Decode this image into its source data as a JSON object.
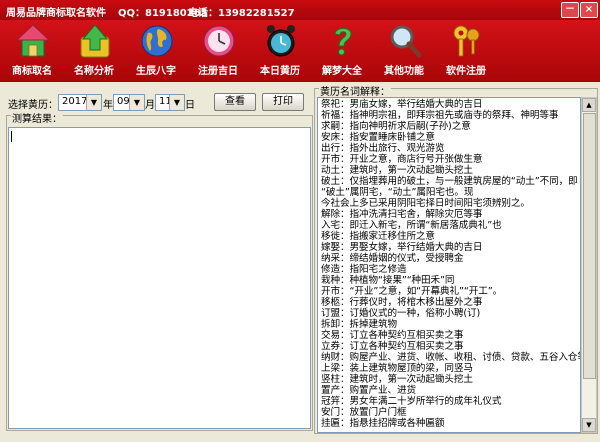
{
  "titlebar": {
    "app_name": "周易品牌商标取名软件",
    "qq": "QQ：819180265",
    "tel": "电话：13982281527",
    "min_symbol": "－",
    "close_symbol": "×"
  },
  "toolbar": [
    {
      "label": "商标取名",
      "icon": "house-icon"
    },
    {
      "label": "名称分析",
      "icon": "upload-arrow-icon"
    },
    {
      "label": "生辰八字",
      "icon": "globe-icon"
    },
    {
      "label": "注册吉日",
      "icon": "clock-icon"
    },
    {
      "label": "本日黄历",
      "icon": "alarm-clock-icon"
    },
    {
      "label": "解梦大全",
      "icon": "question-icon"
    },
    {
      "label": "其他功能",
      "icon": "magnifier-icon"
    },
    {
      "label": "软件注册",
      "icon": "keys-icon"
    }
  ],
  "selector": {
    "label": "选择黄历：",
    "year": "2017",
    "year_unit": "年",
    "month": "09",
    "month_unit": "月",
    "day": "11",
    "day_unit": "日",
    "dropdown_glyph": "▼",
    "view_button": "查看",
    "print_button": "打印"
  },
  "result": {
    "legend": "测算结果：",
    "text": ""
  },
  "glossary": {
    "legend": "黄历名词解释：",
    "lines": [
      "祭祀：男庙女嫁，举行结婚大典的吉日",
      "祈福：指神明宗祖，即拜宗祖先或庙寺的祭拜、神明等事",
      "求嗣：指向神明祈求后嗣(子孙)之意",
      "安床：指安置睡床卧铺之意",
      "出行：指外出旅行、观光游览",
      "开市：开业之意，商店行号开张做生意",
      "动土：建筑时，第一次动起锄头挖土",
      "破土：仅指埋葬用的破土，与一般建筑房屋的“动土”不同，即",
      "“破土”属阴宅，“动土”属阳宅也。现",
      "今社会上多已采用阴阳宅择日时间阳宅须辨别之。",
      "解除：指冲洗清扫宅舍，解除灾厄等事",
      "入宅：即迁入新宅，所谓“新居落成典礼”也",
      "移徙：指搬家迁移住所之意",
      "嫁娶：男娶女嫁，举行结婚大典的吉日",
      "纳采：缔结婚姻的仪式，受授聘金",
      "修造：指阳宅之修造",
      "栽种：种植物“接果”“种田禾”同",
      "开市：“开业”之意，如“开幕典礼”“开工”。",
      "移柩：行葬仪时，将棺木移出屋外之事",
      "订盟：订婚仪式的一种，俗称小聘(订)",
      "拆卸：拆掉建筑物",
      "交易：订立各种契约互相买卖之事",
      "立券：订立各种契约互相买卖之事",
      "纳财：购屋产业、进货、收帐、收租、讨债、贷款、五谷入仓等",
      "上梁：装上建筑物屋顶的梁，同竖马",
      "竖柱：建筑时，第一次动起锄头挖土",
      "置产：购置产业、进货",
      "冠笄：男女年满二十岁所举行的成年礼仪式",
      "安门：放置门户门框",
      "挂匾：指悬挂招牌或各种匾额"
    ]
  },
  "colors": {
    "toolbar_red": "#c0090d",
    "window_bg": "#ece9d8"
  }
}
